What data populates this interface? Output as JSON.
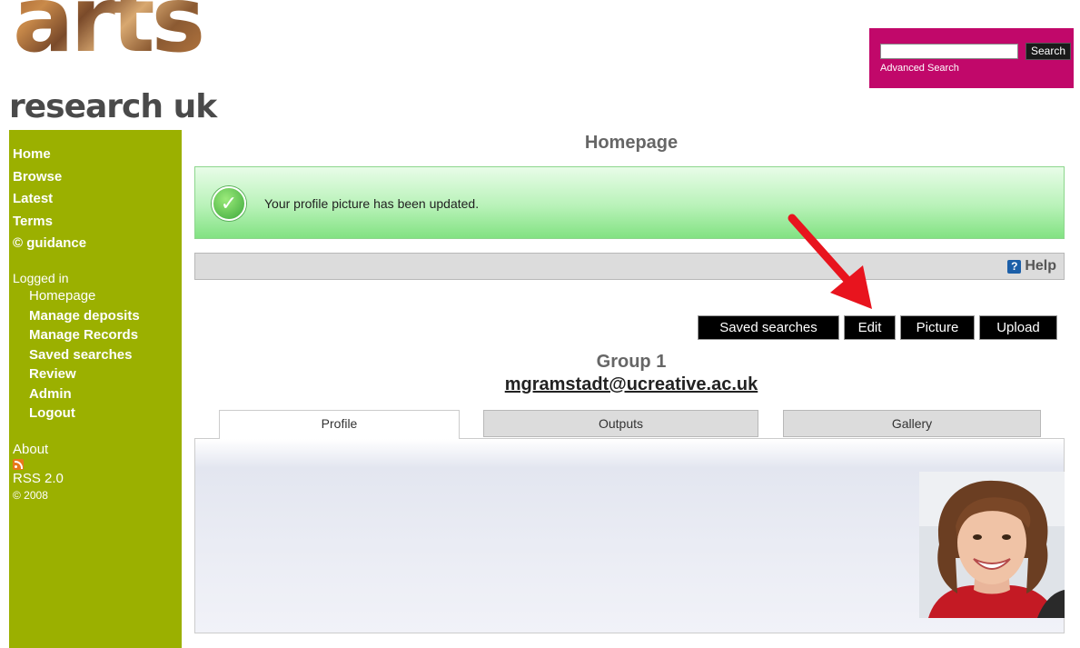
{
  "logo": {
    "word": "arts",
    "subtitle": "research uk"
  },
  "search": {
    "placeholder": "",
    "button_label": "Search",
    "advanced_label": "Advanced Search"
  },
  "nav": {
    "main": [
      "Home",
      "Browse",
      "Latest",
      "Terms",
      "© guidance"
    ],
    "logged_in_label": "Logged in",
    "user_links": [
      "Homepage",
      "Manage deposits",
      "Manage Records",
      "Saved searches",
      "Review",
      "Admin",
      "Logout"
    ],
    "about": "About",
    "rss": "RSS 2.0",
    "copyright": "© 2008"
  },
  "page": {
    "title": "Homepage",
    "message": "Your profile picture has been updated.",
    "help_label": "Help"
  },
  "actions": {
    "saved_searches": "Saved searches",
    "edit": "Edit",
    "picture": "Picture",
    "upload": "Upload"
  },
  "profile": {
    "group": "Group 1",
    "email": "mgramstadt@ucreative.ac.uk"
  },
  "tabs": [
    "Profile",
    "Outputs",
    "Gallery"
  ],
  "colors": {
    "sidebar": "#9bb000",
    "searchbox": "#c1086a",
    "success_green": "#82e282",
    "annotation_arrow": "#e8141e"
  },
  "icons": {
    "success": "check-circle-icon",
    "help": "help-icon",
    "rss": "rss-icon"
  }
}
